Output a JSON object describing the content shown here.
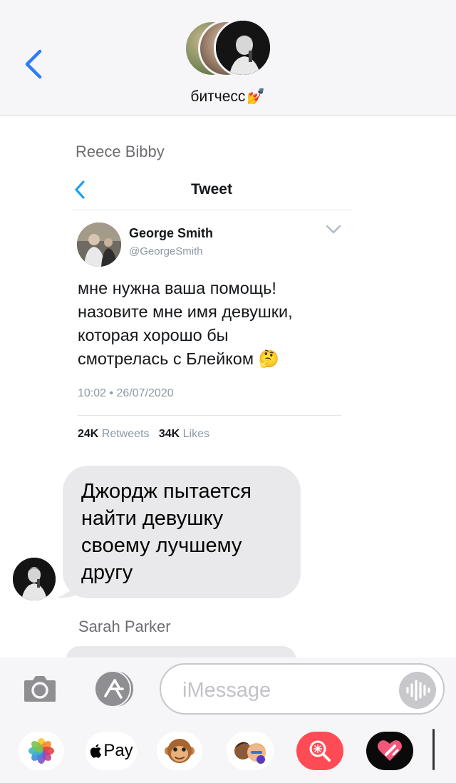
{
  "header": {
    "title": "битчесс",
    "title_emoji": "💅"
  },
  "messages": {
    "sender_1": "Reece Bibby",
    "tweet": {
      "heading": "Tweet",
      "author_name": "George Smith",
      "author_handle": "@GeorgeSmith",
      "text_lines": [
        "мне нужна ваша помощь!",
        "назовите мне имя девушки,",
        "которая хорошо бы",
        "смотрелась с Блейком 🤔"
      ],
      "timestamp": "10:02 • 26/07/2020",
      "retweets_count": "24K",
      "retweets_label": "Retweets",
      "likes_count": "34K",
      "likes_label": "Likes"
    },
    "bubble_lines": [
      "Джордж пытается",
      "найти девушку",
      "своему лучшему",
      "другу"
    ],
    "sender_2": "Sarah Parker"
  },
  "compose": {
    "placeholder": "iMessage"
  },
  "app_drawer": {
    "pay_label": "Pay",
    "apps": [
      "photos-icon",
      "apple-pay-icon",
      "monkey-emoji-icon",
      "memoji-icon",
      "image-search-icon",
      "heart-sticker-icon"
    ]
  },
  "colors": {
    "ios_blue": "#2f7cf6",
    "bubble_gray": "#e9e9eb",
    "header_bg": "#f6f6f8",
    "search_app_red": "#ff4b55"
  }
}
